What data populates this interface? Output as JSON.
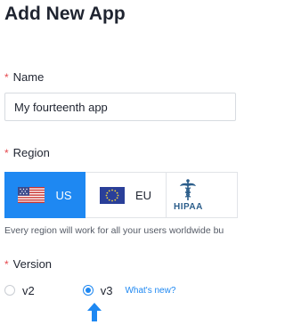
{
  "page": {
    "title": "Add New App"
  },
  "name_field": {
    "label": "Name",
    "value": "My fourteenth app",
    "required_marker": "*"
  },
  "region_field": {
    "label": "Region",
    "required_marker": "*",
    "options": [
      {
        "label": "US",
        "icon": "us-flag-icon",
        "selected": true
      },
      {
        "label": "EU",
        "icon": "eu-flag-icon",
        "selected": false
      },
      {
        "label": "HIPAA",
        "icon": "caduceus-icon",
        "selected": false
      }
    ],
    "note": "Every region will work for all your users worldwide bu"
  },
  "version_field": {
    "label": "Version",
    "required_marker": "*",
    "options": [
      {
        "label": "v2",
        "selected": false
      },
      {
        "label": "v3",
        "selected": true
      }
    ],
    "whats_new_link": "What's new?"
  },
  "colors": {
    "accent": "#1e88f2",
    "required": "#e5484d",
    "text": "#1f2430"
  }
}
